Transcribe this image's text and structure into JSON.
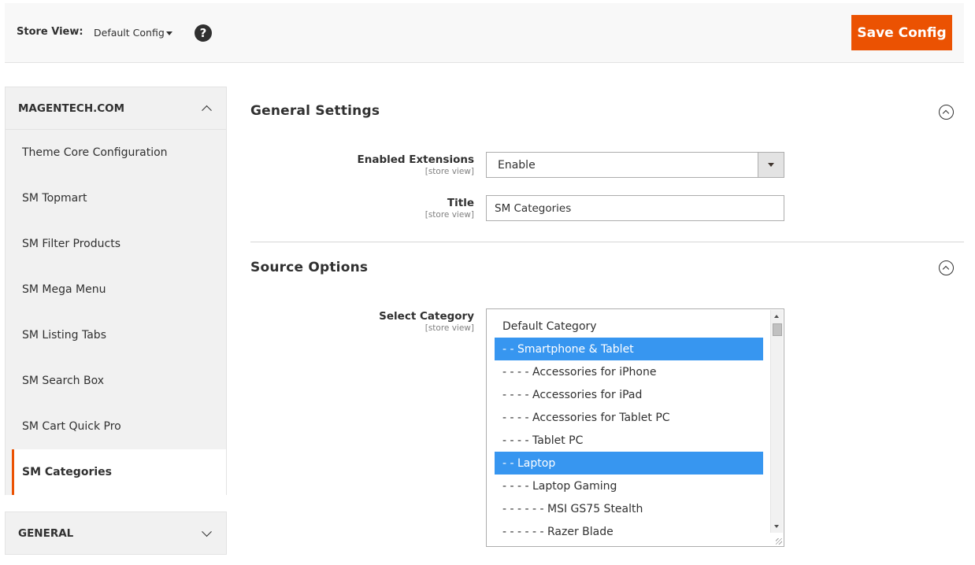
{
  "header": {
    "store_view_label": "Store View:",
    "store_view_value": "Default Config",
    "help_glyph": "?",
    "save_label": "Save Config",
    "accent_color": "#eb5202"
  },
  "sidebar": {
    "section_magentech": {
      "title": "MAGENTECH.COM",
      "state": "expanded"
    },
    "items": [
      {
        "label": "Theme Core Configuration"
      },
      {
        "label": "SM Topmart"
      },
      {
        "label": "SM Filter Products"
      },
      {
        "label": "SM Mega Menu"
      },
      {
        "label": "SM Listing Tabs"
      },
      {
        "label": "SM Search Box"
      },
      {
        "label": "SM Cart Quick Pro"
      },
      {
        "label": "SM Categories",
        "active": true
      }
    ],
    "section_general": {
      "title": "GENERAL",
      "state": "collapsed"
    }
  },
  "general_settings": {
    "title": "General Settings",
    "enabled_extensions": {
      "label": "Enabled Extensions",
      "scope": "[store view]",
      "value": "Enable"
    },
    "title_field": {
      "label": "Title",
      "scope": "[store view]",
      "value": "SM Categories"
    }
  },
  "source_options": {
    "title": "Source Options",
    "select_category": {
      "label": "Select Category",
      "scope": "[store view]",
      "options": [
        {
          "label": "Default Category",
          "selected": false
        },
        {
          "label": "- - Smartphone & Tablet",
          "selected": true
        },
        {
          "label": "- - - - Accessories for iPhone",
          "selected": false
        },
        {
          "label": "- - - - Accessories for iPad",
          "selected": false
        },
        {
          "label": "- - - - Accessories for Tablet PC",
          "selected": false
        },
        {
          "label": "- - - - Tablet PC",
          "selected": false
        },
        {
          "label": "- - Laptop",
          "selected": true
        },
        {
          "label": "- - - - Laptop Gaming",
          "selected": false
        },
        {
          "label": "- - - - - - MSI GS75 Stealth",
          "selected": false
        },
        {
          "label": "- - - - - - Razer Blade",
          "selected": false
        }
      ],
      "selection_color": "#3796f0"
    }
  }
}
